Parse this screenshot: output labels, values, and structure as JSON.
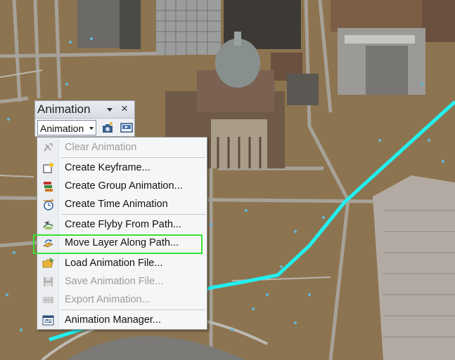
{
  "toolbar": {
    "title": "Animation",
    "menu_button_label": "Animation",
    "close_glyph": "×"
  },
  "menu": {
    "items": [
      {
        "label": "Clear Animation",
        "icon": "clear-animation-icon",
        "enabled": false
      },
      {
        "label": "Create Keyframe...",
        "icon": "create-keyframe-icon",
        "enabled": true
      },
      {
        "label": "Create Group Animation...",
        "icon": "group-animation-icon",
        "enabled": true
      },
      {
        "label": "Create Time Animation",
        "icon": "time-animation-icon",
        "enabled": true
      },
      {
        "label": "Create Flyby From Path...",
        "icon": "flyby-path-icon",
        "enabled": true
      },
      {
        "label": "Move Layer Along Path...",
        "icon": "move-layer-path-icon",
        "enabled": true,
        "highlighted": true
      },
      {
        "label": "Load Animation File...",
        "icon": "open-folder-icon",
        "enabled": true
      },
      {
        "label": "Save Animation File...",
        "icon": "save-icon",
        "enabled": false
      },
      {
        "label": "Export Animation...",
        "icon": "export-film-icon",
        "enabled": false
      },
      {
        "label": "Animation Manager...",
        "icon": "animation-manager-icon",
        "enabled": true
      }
    ]
  },
  "colors": {
    "highlight_box": "#33e533",
    "path_line": "#22f0f0",
    "terrain": "#8d7450"
  }
}
